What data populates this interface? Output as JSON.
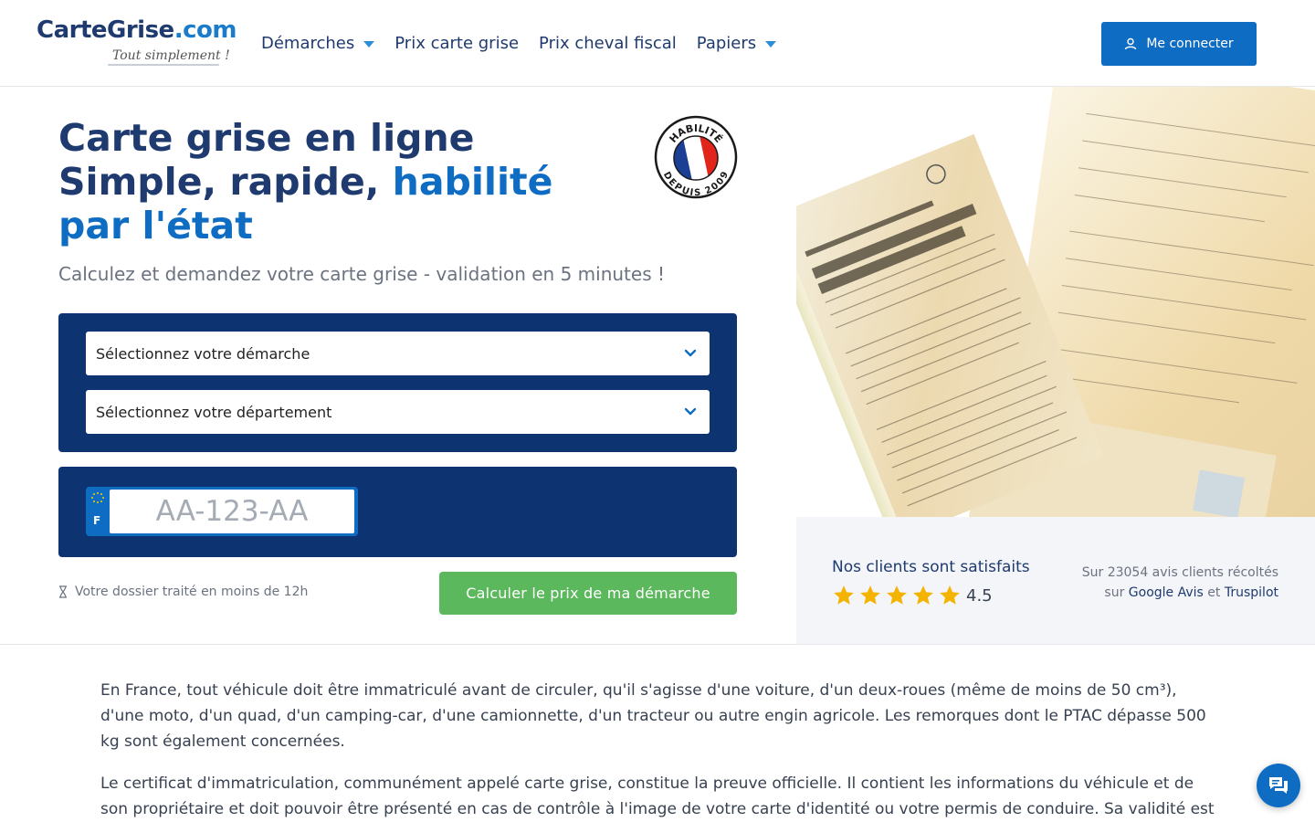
{
  "header": {
    "logo": {
      "main": "CarteGrise",
      "dot": ".",
      "tld": "com",
      "tagline": "Tout simplement !"
    },
    "nav": [
      {
        "label": "Démarches",
        "dropdown": true
      },
      {
        "label": "Prix carte grise",
        "dropdown": false
      },
      {
        "label": "Prix cheval fiscal",
        "dropdown": false
      },
      {
        "label": "Papiers",
        "dropdown": true
      }
    ],
    "login_label": "Me connecter",
    "login_icon": "user-icon"
  },
  "hero": {
    "title_line1": "Carte grise en ligne",
    "title_line2_prefix": "Simple, rapide, ",
    "title_highlight": "habilité par l'état",
    "badge": {
      "top_text": "HABILITÉ",
      "bottom_text": "DEPUIS 2009"
    },
    "subtitle": "Calculez et demandez votre carte grise - validation en 5 minutes !",
    "select_demarche": "Sélectionnez votre démarche",
    "select_departement": "Sélectionnez votre département",
    "plate": {
      "country": "F",
      "placeholder": "AA-123-AA"
    },
    "processing_text": "Votre dossier traité en moins de 12h",
    "calc_button": "Calculer le prix de ma démarche"
  },
  "reviews": {
    "title": "Nos clients sont satisfaits",
    "rating": "4.5",
    "stars": 5,
    "count_prefix": "Sur 23054 avis clients récoltés",
    "sur": "sur",
    "google": "Google Avis",
    "et": "et",
    "trustpilot": "Truspilot"
  },
  "content": {
    "p1": "En France, tout véhicule doit être immatriculé avant de circuler, qu'il s'agisse d'une voiture, d'un deux-roues (même de moins de 50 cm³), d'une moto, d'un quad, d'un camping-car, d'une camionnette, d'un tracteur ou autre engin agricole. Les remorques dont le PTAC dépasse 500 kg sont également concernées.",
    "p2": "Le certificat d'immatriculation, communément appelé carte grise, constitue la preuve officielle. Il contient les informations du véhicule et de son propriétaire et doit pouvoir être présenté en cas de contrôle à l'image de votre carte d'identité ou votre permis de conduire. Sa validité est"
  },
  "colors": {
    "brand_navy": "#1f3a6e",
    "brand_blue": "#0e6dc2",
    "form_bg": "#0d3470",
    "cta_green": "#5cb85c",
    "star_yellow": "#f5b301"
  }
}
